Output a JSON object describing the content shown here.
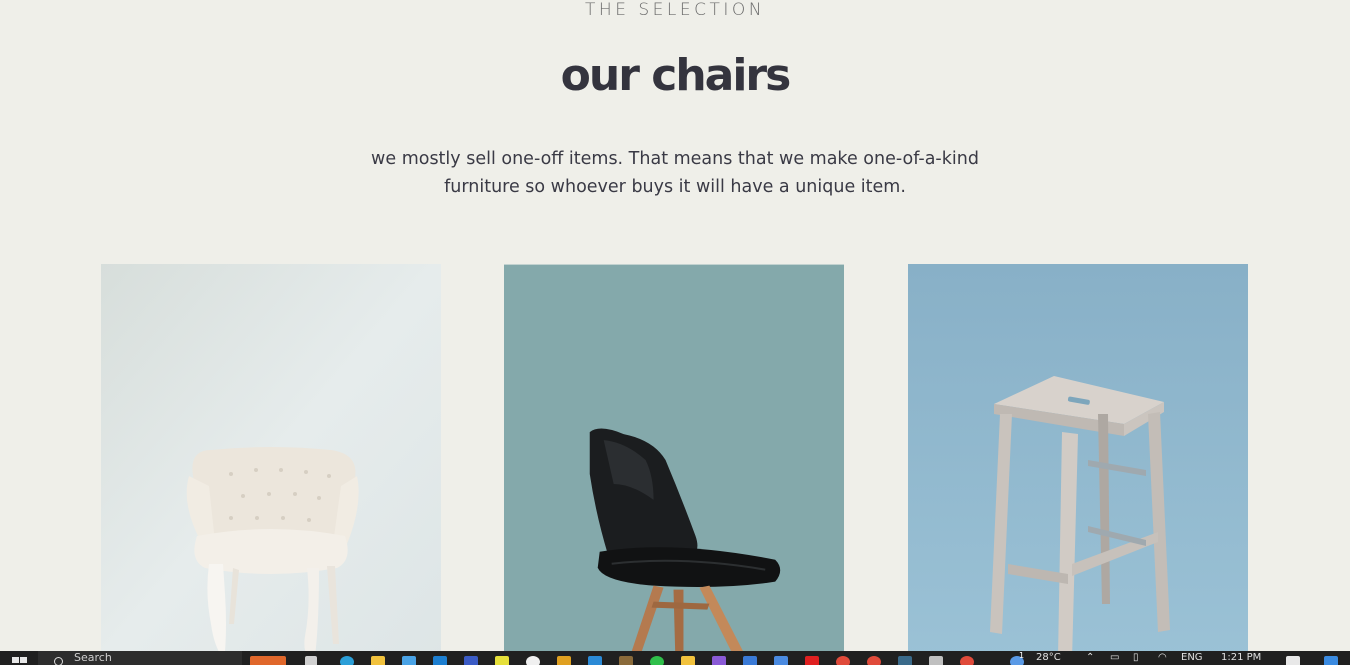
{
  "section": {
    "eyebrow": "THE SELECTION",
    "title": "our chairs",
    "description": "we mostly sell one-off items. That means that we make one-of-a-kind furniture so whoever buys it will have a unique item."
  },
  "products": [
    {
      "image_name": "white-tufted-armchair-image",
      "background": "#dfe5e3"
    },
    {
      "image_name": "black-shell-chair-image",
      "background": "#84a9ab"
    },
    {
      "image_name": "wooden-bar-stool-image",
      "background": "#8fb4c9"
    }
  ],
  "taskbar": {
    "search_placeholder": "Search",
    "temperature": "28°C",
    "language": "ENG",
    "time": "1:21 PM",
    "notification_count": "1"
  },
  "colors": {
    "page_background": "#efefe9",
    "heading": "#34343e",
    "taskbar": "#202020"
  }
}
